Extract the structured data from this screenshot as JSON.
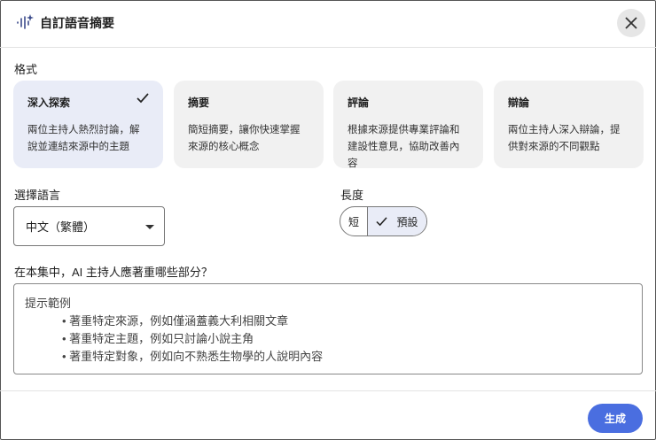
{
  "header": {
    "title": "自訂語音摘要"
  },
  "format": {
    "label": "格式",
    "cards": [
      {
        "title": "深入探索",
        "desc": "兩位主持人熱烈討論，解說並連結來源中的主題",
        "selected": true
      },
      {
        "title": "摘要",
        "desc": "簡短摘要，讓你快速掌握來源的核心概念",
        "selected": false
      },
      {
        "title": "評論",
        "desc": "根據來源提供專業評論和建設性意見，協助改善內容",
        "selected": false
      },
      {
        "title": "辯論",
        "desc": "兩位主持人深入辯論，提供對來源的不同觀點",
        "selected": false
      }
    ]
  },
  "language": {
    "label": "選擇語言",
    "value": "中文（繁體）"
  },
  "length": {
    "label": "長度",
    "options": [
      "短",
      "預設"
    ],
    "selected": "預設"
  },
  "focus": {
    "label": "在本集中，AI 主持人應著重哪些部分？",
    "placeholder_title": "提示範例",
    "placeholder_items": [
      "• 著重特定來源，例如僅涵蓋義大利相關文章",
      "• 著重特定主題，例如只討論小說主角",
      "• 著重特定對象，例如向不熟悉生物學的人說明內容"
    ]
  },
  "footer": {
    "generate": "生成"
  },
  "colors": {
    "accent": "#4a6ee0",
    "selected_bg": "#e9ecf7"
  }
}
